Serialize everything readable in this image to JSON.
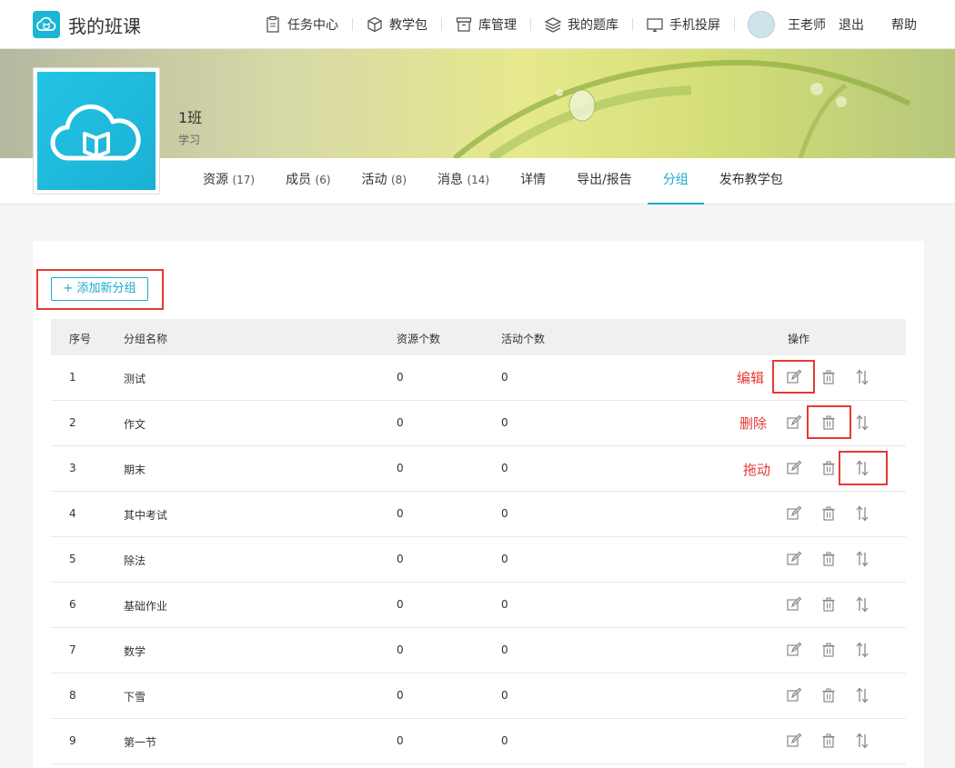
{
  "header": {
    "brand": "我的班课",
    "nav": [
      {
        "label": "任务中心",
        "icon": "clipboard-icon"
      },
      {
        "label": "教学包",
        "icon": "box-icon"
      },
      {
        "label": "库管理",
        "icon": "archive-icon"
      },
      {
        "label": "我的题库",
        "icon": "layers-icon"
      },
      {
        "label": "手机投屏",
        "icon": "cast-icon"
      }
    ],
    "user": "王老师",
    "logout": "退出",
    "help": "帮助"
  },
  "class_info": {
    "name": "1班",
    "subject": "学习"
  },
  "tabs": [
    {
      "label": "资源",
      "count": "(17)"
    },
    {
      "label": "成员",
      "count": "(6)"
    },
    {
      "label": "活动",
      "count": "(8)"
    },
    {
      "label": "消息",
      "count": "(14)"
    },
    {
      "label": "详情",
      "count": ""
    },
    {
      "label": "导出/报告",
      "count": ""
    },
    {
      "label": "分组",
      "count": ""
    },
    {
      "label": "发布教学包",
      "count": ""
    }
  ],
  "active_tab": "分组",
  "add_button": "+ 添加新分组",
  "table": {
    "headers": {
      "idx": "序号",
      "name": "分组名称",
      "resources": "资源个数",
      "activities": "活动个数",
      "ops": "操作"
    },
    "rows": [
      {
        "idx": "1",
        "name": "测试",
        "resources": "0",
        "activities": "0"
      },
      {
        "idx": "2",
        "name": "作文",
        "resources": "0",
        "activities": "0"
      },
      {
        "idx": "3",
        "name": "期末",
        "resources": "0",
        "activities": "0"
      },
      {
        "idx": "4",
        "name": "其中考试",
        "resources": "0",
        "activities": "0"
      },
      {
        "idx": "5",
        "name": "除法",
        "resources": "0",
        "activities": "0"
      },
      {
        "idx": "6",
        "name": "基础作业",
        "resources": "0",
        "activities": "0"
      },
      {
        "idx": "7",
        "name": "数学",
        "resources": "0",
        "activities": "0"
      },
      {
        "idx": "8",
        "name": "下雪",
        "resources": "0",
        "activities": "0"
      },
      {
        "idx": "9",
        "name": "第一节",
        "resources": "0",
        "activities": "0"
      }
    ]
  },
  "annotations": {
    "edit": "编辑",
    "delete": "删除",
    "drag": "拖动"
  },
  "colors": {
    "accent": "#1aa9cf",
    "annotation": "#e53935"
  }
}
